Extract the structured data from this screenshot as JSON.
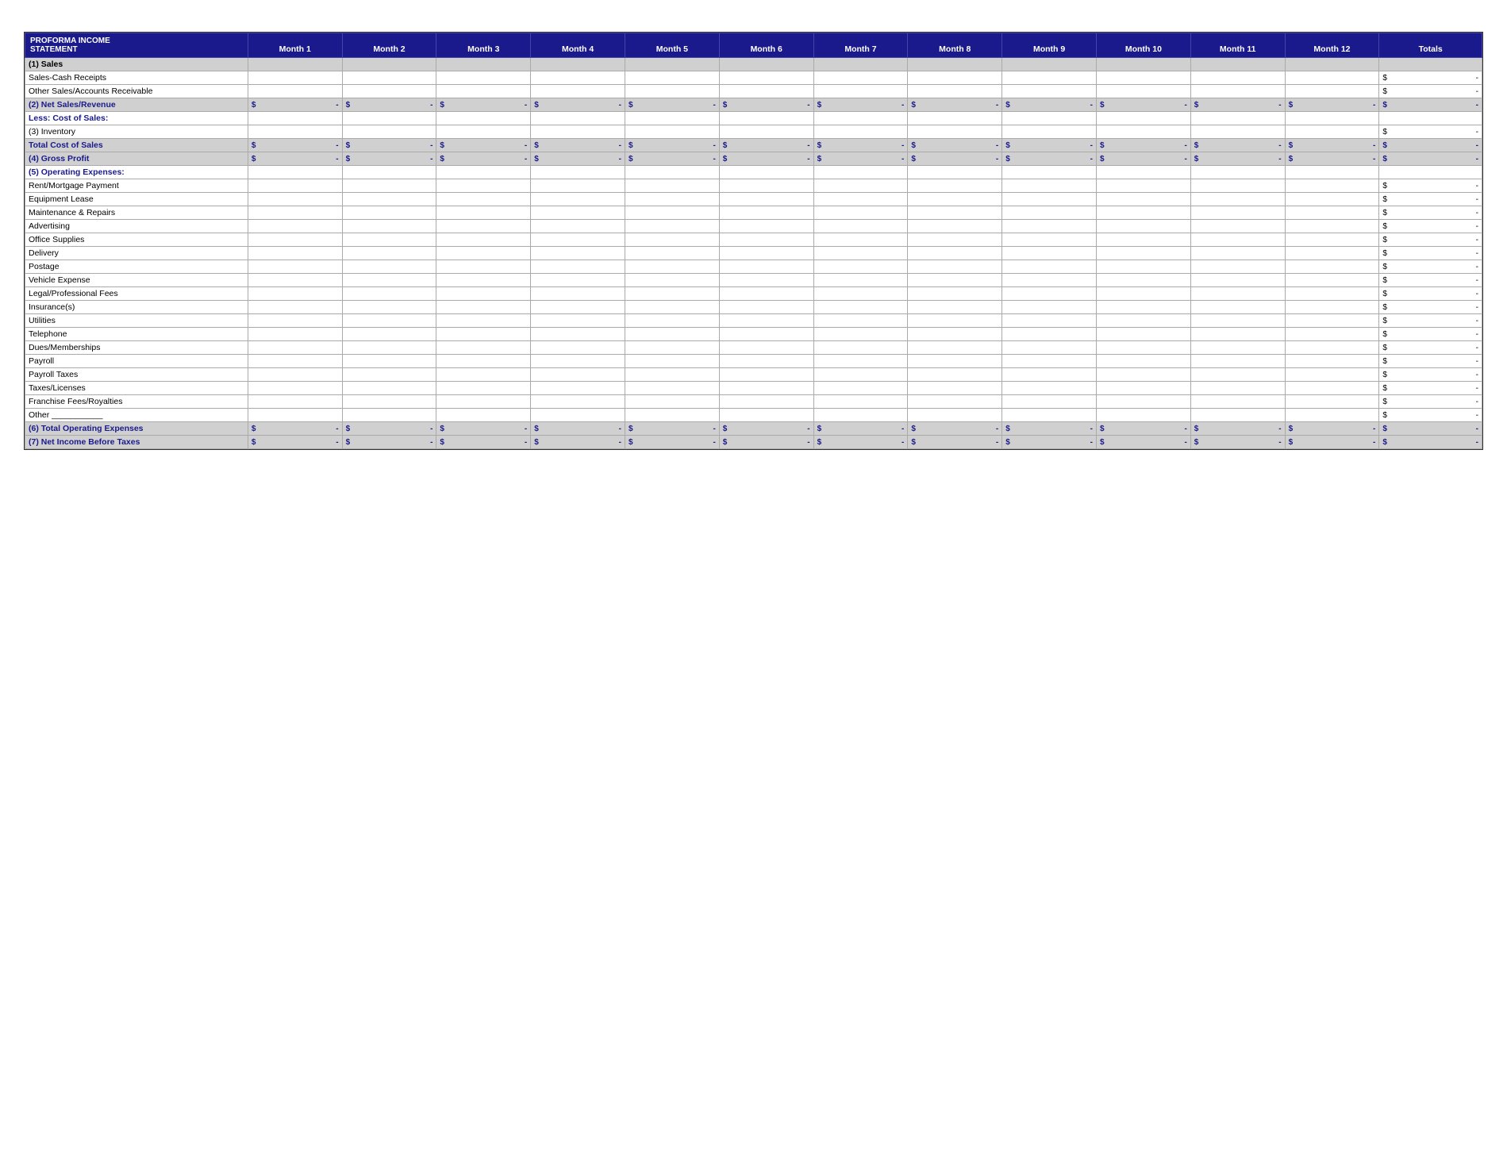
{
  "title": {
    "line1": "PROFORMA INCOME",
    "line2": "STATEMENT"
  },
  "columns": {
    "months": [
      "Month 1",
      "Month 2",
      "Month 3",
      "Month 4",
      "Month 5",
      "Month 6",
      "Month 7",
      "Month 8",
      "Month 9",
      "Month 10",
      "Month 11",
      "Month 12"
    ],
    "totals": "Totals"
  },
  "rows": [
    {
      "type": "section-header",
      "label": "(1) Sales",
      "hasDollar": false,
      "values": []
    },
    {
      "type": "data-row",
      "label": "Sales-Cash Receipts",
      "hasDollar": false,
      "values": [],
      "totalDollar": true,
      "totalValue": "-"
    },
    {
      "type": "data-row",
      "label": "Other Sales/Accounts Receivable",
      "hasDollar": false,
      "values": [],
      "totalDollar": true,
      "totalValue": "-"
    },
    {
      "type": "summary-row",
      "label": "(2) Net Sales/Revenue",
      "hasDollar": true,
      "dollarValue": "-",
      "values": [
        "$",
        "-",
        "$",
        "-",
        "$",
        "-",
        "$",
        "-",
        "$",
        "-",
        "$",
        "-",
        "$",
        "-",
        "$",
        "-",
        "$",
        "-",
        "$",
        "-",
        "$",
        "-",
        "$",
        "-"
      ],
      "totalDollar": true,
      "totalValue": "-"
    },
    {
      "type": "section-title",
      "label": "Less: Cost of Sales:",
      "hasDollar": false,
      "values": []
    },
    {
      "type": "data-row",
      "label": "(3) Inventory",
      "hasDollar": false,
      "values": [],
      "totalDollar": true,
      "totalValue": "-"
    },
    {
      "type": "summary-row",
      "label": "Total Cost of Sales",
      "hasDollar": true,
      "values": [],
      "totalDollar": true,
      "totalValue": "-"
    },
    {
      "type": "summary-row",
      "label": "(4) Gross Profit",
      "hasDollar": true,
      "values": [],
      "totalDollar": true,
      "totalValue": "-"
    },
    {
      "type": "section-title",
      "label": "(5) Operating Expenses:",
      "hasDollar": false,
      "values": []
    },
    {
      "type": "data-row",
      "label": "Rent/Mortgage Payment",
      "hasDollar": false,
      "values": [],
      "totalDollar": true,
      "totalValue": "-"
    },
    {
      "type": "data-row",
      "label": "Equipment Lease",
      "hasDollar": false,
      "values": [],
      "totalDollar": true,
      "totalValue": "-"
    },
    {
      "type": "data-row",
      "label": "Maintenance & Repairs",
      "hasDollar": false,
      "values": [],
      "totalDollar": true,
      "totalValue": "-"
    },
    {
      "type": "data-row",
      "label": "Advertising",
      "hasDollar": false,
      "values": [],
      "totalDollar": true,
      "totalValue": "-"
    },
    {
      "type": "data-row",
      "label": "Office Supplies",
      "hasDollar": false,
      "values": [],
      "totalDollar": true,
      "totalValue": "-"
    },
    {
      "type": "data-row",
      "label": "Delivery",
      "hasDollar": false,
      "values": [],
      "totalDollar": true,
      "totalValue": "-"
    },
    {
      "type": "data-row",
      "label": "Postage",
      "hasDollar": false,
      "values": [],
      "totalDollar": true,
      "totalValue": "-"
    },
    {
      "type": "data-row",
      "label": "Vehicle Expense",
      "hasDollar": false,
      "values": [],
      "totalDollar": true,
      "totalValue": "-"
    },
    {
      "type": "data-row",
      "label": "Legal/Professional Fees",
      "hasDollar": false,
      "values": [],
      "totalDollar": true,
      "totalValue": "-"
    },
    {
      "type": "data-row",
      "label": "Insurance(s)",
      "hasDollar": false,
      "values": [],
      "totalDollar": true,
      "totalValue": "-"
    },
    {
      "type": "data-row",
      "label": "Utilities",
      "hasDollar": false,
      "values": [],
      "totalDollar": true,
      "totalValue": "-"
    },
    {
      "type": "data-row",
      "label": "Telephone",
      "hasDollar": false,
      "values": [],
      "totalDollar": true,
      "totalValue": "-"
    },
    {
      "type": "data-row",
      "label": "Dues/Memberships",
      "hasDollar": false,
      "values": [],
      "totalDollar": true,
      "totalValue": "-"
    },
    {
      "type": "data-row",
      "label": "Payroll",
      "hasDollar": false,
      "values": [],
      "totalDollar": true,
      "totalValue": "-"
    },
    {
      "type": "data-row",
      "label": "Payroll Taxes",
      "hasDollar": false,
      "values": [],
      "totalDollar": true,
      "totalValue": "-"
    },
    {
      "type": "data-row",
      "label": "Taxes/Licenses",
      "hasDollar": false,
      "values": [],
      "totalDollar": true,
      "totalValue": "-"
    },
    {
      "type": "data-row",
      "label": "Franchise Fees/Royalties",
      "hasDollar": false,
      "values": [],
      "totalDollar": true,
      "totalValue": "-"
    },
    {
      "type": "data-row",
      "label": "Other ___________",
      "hasDollar": false,
      "values": [],
      "totalDollar": true,
      "totalValue": "-"
    },
    {
      "type": "summary-row",
      "label": "(6) Total Operating Expenses",
      "hasDollar": true,
      "values": [],
      "totalDollar": true,
      "totalValue": "-"
    },
    {
      "type": "summary-row",
      "label": "(7) Net Income Before Taxes",
      "hasDollar": true,
      "values": [],
      "totalDollar": true,
      "totalValue": "-"
    }
  ]
}
